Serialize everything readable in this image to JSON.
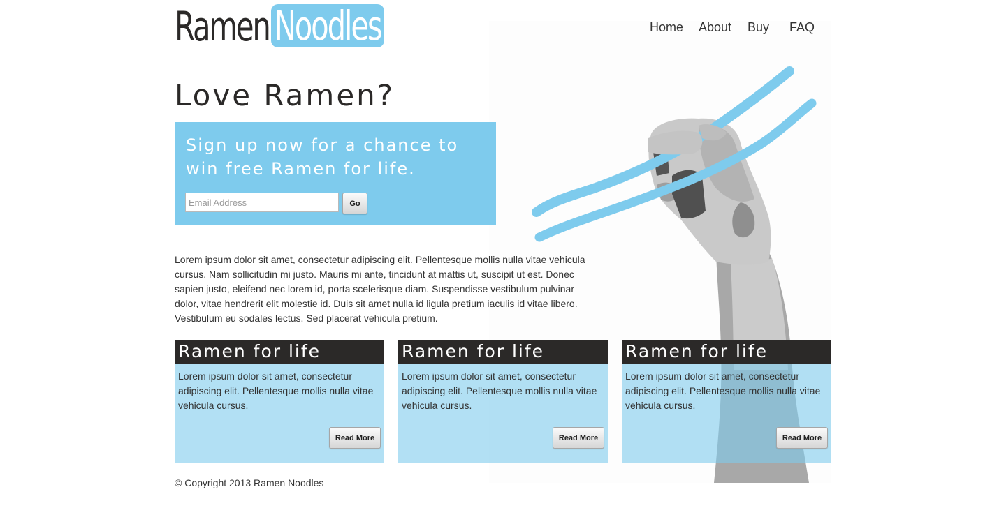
{
  "logo": {
    "word1": "Ramen",
    "word2": "Noodles"
  },
  "nav": [
    {
      "label": "Home"
    },
    {
      "label": "About"
    },
    {
      "label": "Buy"
    },
    {
      "label": "FAQ"
    }
  ],
  "hero": {
    "headline": "Love Ramen?",
    "signup_text": "Sign up now for a chance to win free Ramen for life.",
    "email_placeholder": "Email Address",
    "email_value": "",
    "go_label": "Go"
  },
  "intro": "Lorem ipsum dolor sit amet, consectetur adipiscing elit. Pellentesque mollis nulla vitae vehicula cursus. Nam sollicitudin mi justo. Mauris mi ante, tincidunt at mattis ut, suscipit ut est. Donec sapien justo, eleifend nec lorem id, porta scelerisque diam. Suspendisse vestibulum pulvinar dolor, vitae hendrerit elit molestie id. Duis sit amet nulla id ligula pretium iaculis id vitae libero. Vestibulum eu sodales lectus. Sed placerat vehicula pretium.",
  "cards": [
    {
      "title": "Ramen for life",
      "body": "Lorem ipsum dolor sit amet, consectetur adipiscing elit. Pellentesque mollis nulla vitae vehicula cursus.",
      "button": "Read More"
    },
    {
      "title": "Ramen for life",
      "body": "Lorem ipsum dolor sit amet, consectetur adipiscing elit. Pellentesque mollis nulla vitae vehicula cursus.",
      "button": "Read More"
    },
    {
      "title": "Ramen for life",
      "body": "Lorem ipsum dolor sit amet, consectetur adipiscing elit. Pellentesque mollis nulla vitae vehicula cursus.",
      "button": "Read More"
    }
  ],
  "footer": "© Copyright 2013 Ramen Noodles",
  "colors": {
    "accent": "#7ecbed",
    "card_background": "#b3e0f3",
    "card_header": "#2b2928",
    "text": "#333333"
  },
  "hero_image": "hand-holding-chopsticks-illustration"
}
